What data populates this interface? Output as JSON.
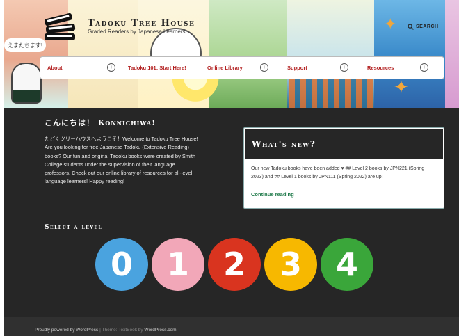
{
  "header": {
    "site_title": "Tadoku Tree House",
    "tagline": "Graded Readers by Japanese Learners!",
    "search_label": "SEARCH",
    "bubble_text": "えまたちます!"
  },
  "nav": {
    "items": [
      {
        "label": "About",
        "has_submenu": true
      },
      {
        "label": "Tadoku 101: Start Here!",
        "has_submenu": false
      },
      {
        "label": "Online Library",
        "has_submenu": true
      },
      {
        "label": "Support",
        "has_submenu": true
      },
      {
        "label": "Resources",
        "has_submenu": true
      }
    ]
  },
  "intro": {
    "heading": "こんにちは！ Konnichiwa!",
    "text": "たどくツリーハウスへようこそ！Welcome to Tadoku Tree House! Are you looking for free Japanese Tadoku (Extensive Reading) books? Our fun and original Tadoku books were created by Smith College students under the supervision of their language professors. Check out our online library of resources for all-level language learners! Happy reading!"
  },
  "news": {
    "title": "What's new?",
    "body": "Our new Tadoku books have been added ♥ ## Level 2 books by JPN221 (Spring 2023) and ## Level 1 books by JPN111 (Spring 2022) are up!",
    "link": "Continue reading"
  },
  "levels": {
    "heading": "Select a level",
    "items": [
      {
        "label": "0",
        "color": "#4aa3df"
      },
      {
        "label": "1",
        "color": "#f2a7b8"
      },
      {
        "label": "2",
        "color": "#d9341f"
      },
      {
        "label": "3",
        "color": "#f7b800"
      },
      {
        "label": "4",
        "color": "#3aa63a"
      }
    ]
  },
  "footer": {
    "powered": "Proudly powered by WordPress",
    "sep": " | ",
    "theme": "Theme: TextBook by ",
    "wp": "WordPress.com",
    "dot": "."
  }
}
